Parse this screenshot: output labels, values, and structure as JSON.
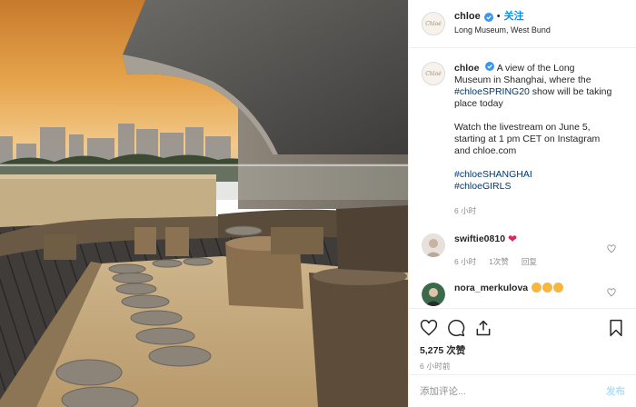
{
  "post": {
    "username": "chloe",
    "follow_label": "关注",
    "separator": "•",
    "location": "Long Museum, West Bund",
    "avatar_text": "Chloé",
    "caption": {
      "username": "chloe",
      "text_before_tag": "A view of the Long Museum in Shanghai, where the ",
      "tag1": "#chloeSPRING20",
      "text_after_tag": " show will be taking place today",
      "paragraph2": "Watch the livestream on June 5, starting at 1 pm CET on Instagram and chloe.com",
      "tag2": "#chloeSHANGHAI",
      "tag3": "#chloeGIRLS",
      "time": "6 小时"
    },
    "comments": [
      {
        "username": "swiftie0810",
        "emoji": "❤",
        "time": "6 小时",
        "likes": "1次赞",
        "reply": "回复"
      },
      {
        "username": "nora_merkulova",
        "emoji_colors": [
          "#f6b73c",
          "#f6b73c",
          "#f6b73c"
        ]
      }
    ],
    "likes": "5,275 次赞",
    "timestamp": "6 小时前",
    "comment_placeholder": "添加评论...",
    "post_label": "发布"
  },
  "colors": {
    "link": "#0095f6",
    "hashtag": "#00376b",
    "muted": "#8e8e8e",
    "post_disabled": "#b2dffc"
  }
}
